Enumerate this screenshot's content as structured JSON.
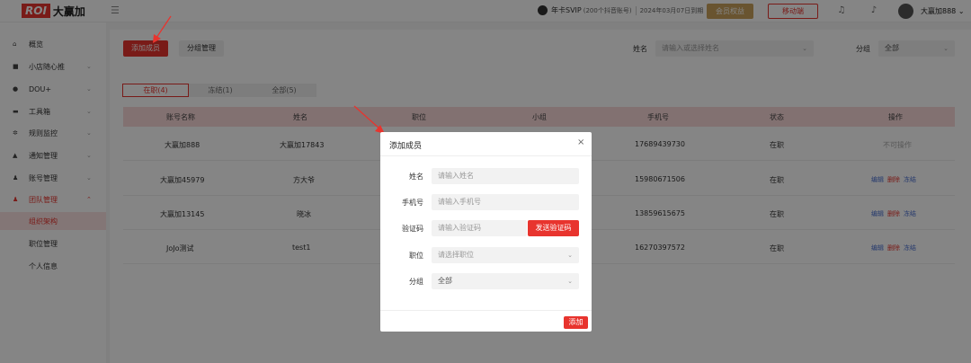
{
  "header": {
    "logo_box": "ROI",
    "logo_text": "大赢加",
    "vip_label": "年卡SVIP",
    "vip_sub": "(200个抖音账号)",
    "vip_date": "2024年03月07日到期",
    "btn_vip": "会员权益",
    "btn_mobile": "移动端",
    "username": "大赢加888"
  },
  "sidebar": {
    "items": [
      {
        "label": "概览",
        "icon": "home-icon"
      },
      {
        "label": "小店随心推",
        "icon": "store-icon"
      },
      {
        "label": "DOU+",
        "icon": "fire-icon"
      },
      {
        "label": "工具箱",
        "icon": "toolbox-icon"
      },
      {
        "label": "规则监控",
        "icon": "gear-icon"
      },
      {
        "label": "通知管理",
        "icon": "bell-icon"
      },
      {
        "label": "账号管理",
        "icon": "user-icon"
      },
      {
        "label": "团队管理",
        "icon": "team-icon"
      }
    ],
    "sub_items": [
      {
        "label": "组织架构"
      },
      {
        "label": "职位管理"
      },
      {
        "label": "个人信息"
      }
    ]
  },
  "toolbar": {
    "add_member": "添加成员",
    "group_manage": "分组管理",
    "name_label": "姓名",
    "name_placeholder": "请输入或选择姓名",
    "group_label": "分组",
    "group_value": "全部"
  },
  "tabs": [
    {
      "label": "在职(4)"
    },
    {
      "label": "冻结(1)"
    },
    {
      "label": "全部(5)"
    }
  ],
  "table": {
    "headers": [
      "账号名称",
      "姓名",
      "职位",
      "小组",
      "手机号",
      "状态",
      "操作"
    ],
    "rows": [
      {
        "account": "大赢加888",
        "name": "大赢加17843",
        "phone": "17689439730",
        "status": "在职",
        "ops_text": "不可操作"
      },
      {
        "account": "大赢加45979",
        "name": "方大爷",
        "phone": "15980671506",
        "status": "在职"
      },
      {
        "account": "大赢加13145",
        "name": "晓冰",
        "phone": "13859615675",
        "status": "在职"
      },
      {
        "account": "JoJo测试",
        "name": "test1",
        "phone": "16270397572",
        "status": "在职"
      }
    ],
    "op_edit": "编辑",
    "op_delete": "删除",
    "op_freeze": "冻结"
  },
  "modal": {
    "title": "添加成员",
    "close": "×",
    "fields": [
      {
        "label": "姓名",
        "placeholder": "请输入姓名"
      },
      {
        "label": "手机号",
        "placeholder": "请输入手机号"
      },
      {
        "label": "验证码",
        "placeholder": "请输入验证码"
      },
      {
        "label": "职位",
        "placeholder": "请选择职位"
      },
      {
        "label": "分组",
        "placeholder": "全部"
      }
    ],
    "send_code": "发送验证码",
    "submit": "添加"
  },
  "colors": {
    "accent": "#e8342e",
    "gold": "#c9a25c",
    "link": "#4a6fd1"
  }
}
